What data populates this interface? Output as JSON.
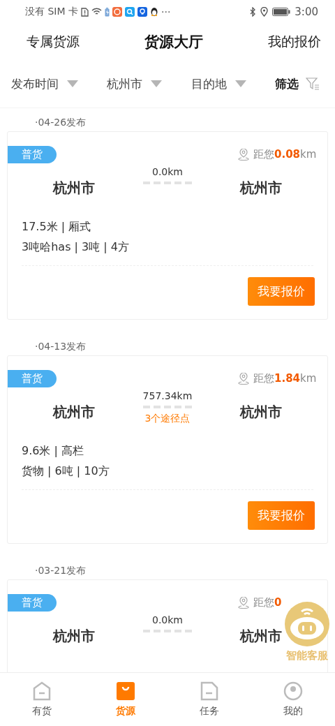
{
  "status_bar": {
    "carrier": "没有 SIM 卡",
    "more": "···",
    "time": "3:00"
  },
  "top_tabs": [
    {
      "label": "专属货源",
      "selected": false
    },
    {
      "label": "货源大厅",
      "selected": true
    },
    {
      "label": "我的报价",
      "selected": false
    }
  ],
  "filters": [
    {
      "label": "发布时间",
      "kind": "dropdown"
    },
    {
      "label": "杭州市",
      "kind": "dropdown"
    },
    {
      "label": "目的地",
      "kind": "dropdown"
    },
    {
      "label": "筛选",
      "kind": "filter"
    }
  ],
  "listings": [
    {
      "date": "·04-26发布",
      "tag": "普货",
      "distance_prefix": "距您",
      "distance_value": "0.08",
      "distance_unit": "km",
      "origin": "杭州市",
      "route_distance": "0.0km",
      "destination": "杭州市",
      "specs": [
        "17.5米 | 厢式",
        "3吨哈has | 3吨 | 4方"
      ],
      "action": "我要报价"
    },
    {
      "date": "·04-13发布",
      "tag": "普货",
      "distance_prefix": "距您",
      "distance_value": "1.84",
      "distance_unit": "km",
      "origin": "杭州市",
      "route_distance": "757.34km",
      "waypoints": "3个途径点",
      "destination": "杭州市",
      "specs": [
        "9.6米 | 高栏",
        "货物 | 6吨 | 10方"
      ],
      "action": "我要报价"
    },
    {
      "date": "·03-21发布",
      "tag": "普货",
      "distance_prefix": "距您",
      "distance_value": "0",
      "origin": "杭州市",
      "route_distance": "0.0km",
      "destination": "杭州市"
    }
  ],
  "assistant": {
    "label": "智能客服"
  },
  "bottom_tabs": [
    {
      "label": "有货",
      "kind": "home",
      "selected": false
    },
    {
      "label": "货源",
      "kind": "bag",
      "selected": true
    },
    {
      "label": "任务",
      "kind": "doc",
      "selected": false
    },
    {
      "label": "我的",
      "kind": "person",
      "selected": false
    }
  ]
}
